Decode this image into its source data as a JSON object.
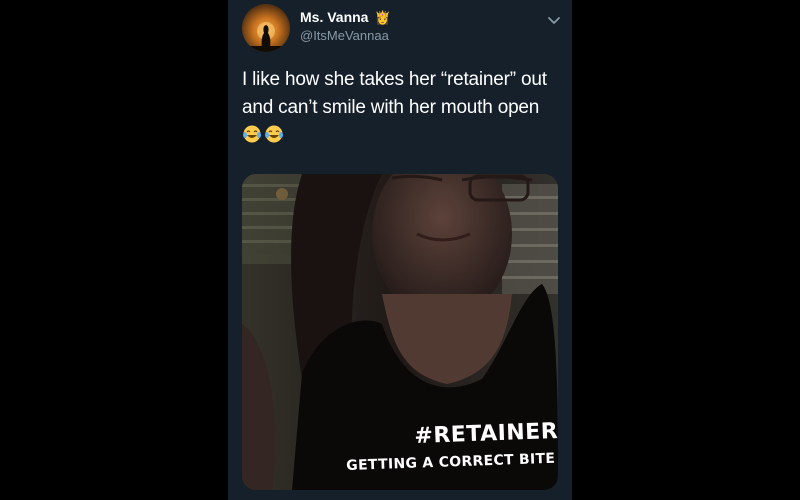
{
  "tweet": {
    "author": {
      "display_name": "Ms. Vanna",
      "name_badge": "👸",
      "handle": "@ItsMeVannaa",
      "avatar_icon": "avatar-sunset-silhouette"
    },
    "more_icon": "chevron-down-icon",
    "text_line1": "I like how she takes her “retainer” out",
    "text_line2": "and can’t smile with her mouth open",
    "emojis": [
      "face-with-tears-of-joy",
      "face-with-tears-of-joy"
    ],
    "media": {
      "caption_hashtag": "#RETAINER",
      "caption_text": "GETTING A CORRECT BITE BE"
    }
  },
  "colors": {
    "page_background": "#000000",
    "tweet_background": "#15202b",
    "primary_text": "#ffffff",
    "secondary_text": "#8899a6"
  }
}
